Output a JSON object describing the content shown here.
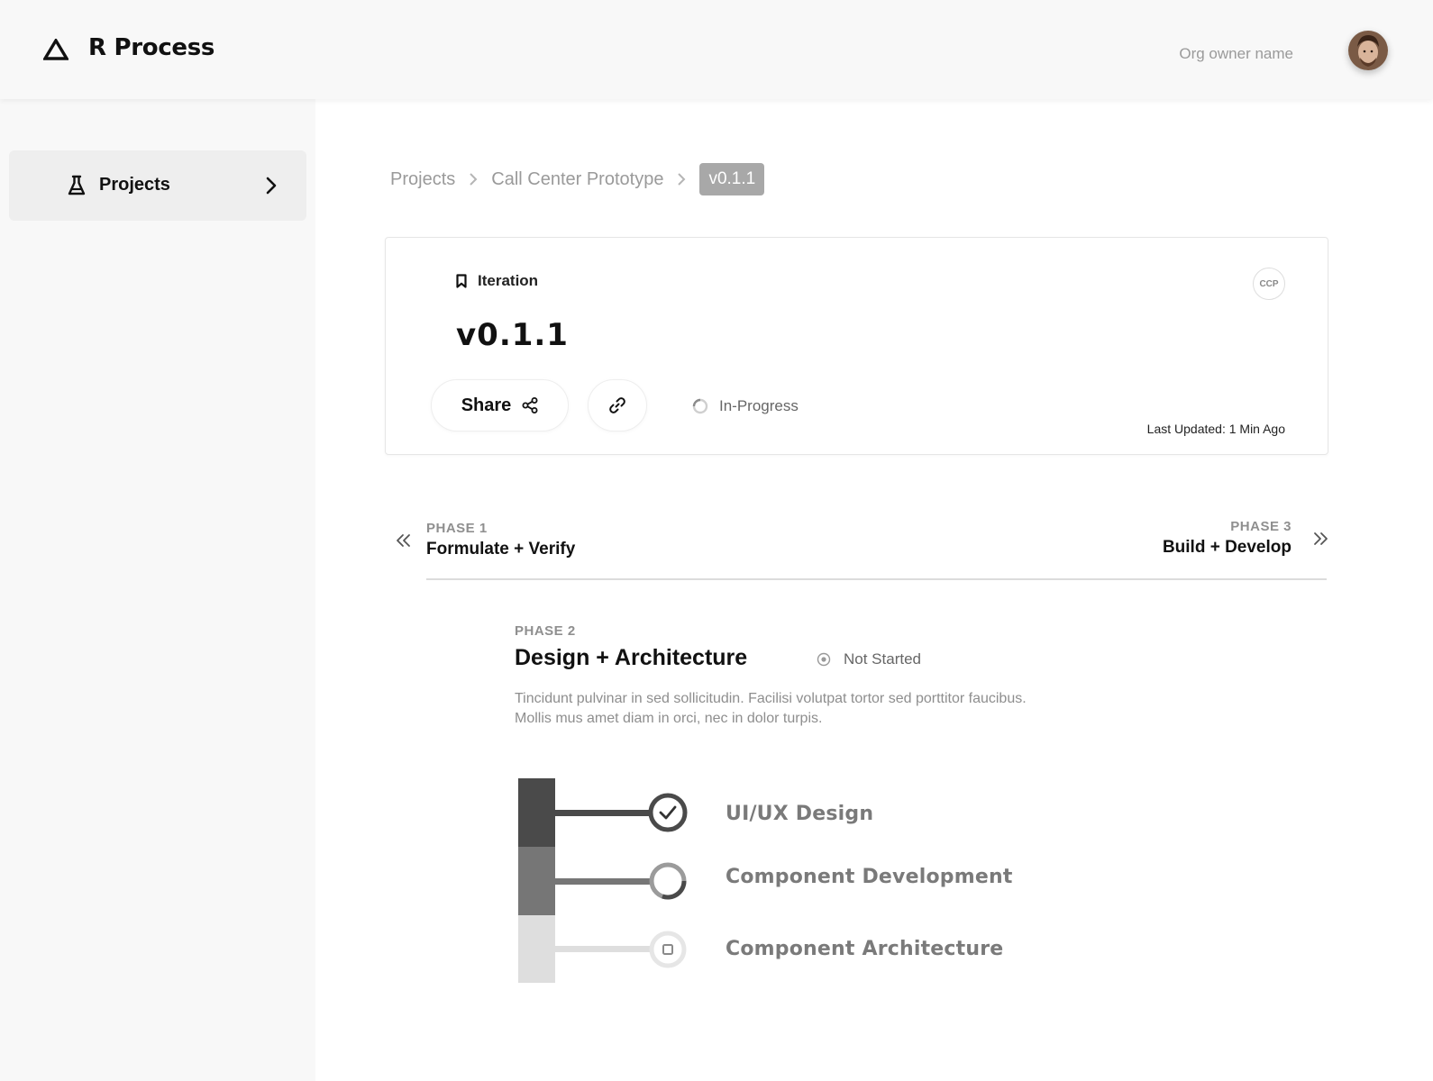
{
  "header": {
    "app_title": "R Process",
    "logo_icon": "triangle-logo-icon",
    "org_owner": "Org owner name",
    "avatar_icon": "user-avatar"
  },
  "sidebar": {
    "items": [
      {
        "label": "Projects",
        "icon": "flask-icon",
        "active": true
      }
    ]
  },
  "breadcrumb": {
    "items": [
      "Projects",
      "Call Center Prototype"
    ],
    "current": "v0.1.1"
  },
  "iteration": {
    "label": "Iteration",
    "title": "v0.1.1",
    "badge": "CCP",
    "share_label": "Share",
    "status": "In-Progress",
    "last_updated": "Last Updated: 1 Min Ago"
  },
  "phases": {
    "prev": {
      "number": "PHASE 1",
      "name": "Formulate + Verify"
    },
    "next": {
      "number": "PHASE 3",
      "name": "Build + Develop"
    },
    "current": {
      "number": "PHASE 2",
      "name": "Design + Architecture",
      "status": "Not Started",
      "description": "Tincidunt pulvinar in sed sollicitudin. Facilisi volutpat tortor sed porttitor faucibus. Mollis mus amet diam in orci, nec in dolor turpis."
    }
  },
  "steps": [
    {
      "label": "UI/UX Design",
      "state": "complete",
      "color": "#4a4a4a"
    },
    {
      "label": "Component Development",
      "state": "in-progress",
      "color": "#767676"
    },
    {
      "label": "Component Architecture",
      "state": "not-started",
      "color": "#dedede"
    }
  ],
  "colors": {
    "page_bg": "#ffffff",
    "sidebar_bg": "#f8f8f8",
    "active_nav_bg": "#eeeeee",
    "breadcrumb_current_bg": "#a8a8a8",
    "muted_text": "#9a9a9a"
  }
}
